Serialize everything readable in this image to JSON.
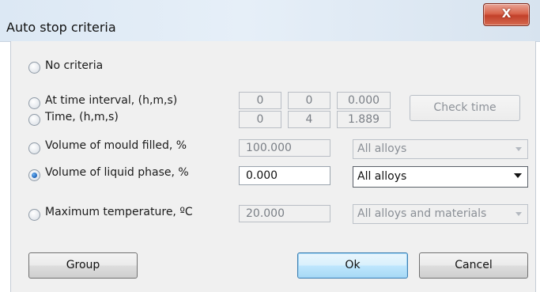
{
  "window": {
    "title": "Auto stop criteria",
    "close_glyph": "X",
    "close_icon": "close-icon"
  },
  "options": {
    "no_criteria": "No criteria",
    "time_interval": "At time interval, (h,m,s)",
    "time": "Time, (h,m,s)",
    "mould_filled": "Volume of mould filled, %",
    "liquid_phase": "Volume of liquid phase, %",
    "max_temperature": "Maximum temperature, ºC",
    "selected": "liquid_phase"
  },
  "fields": {
    "interval_h": "0",
    "interval_m": "0",
    "interval_s": "0.000",
    "time_h": "0",
    "time_m": "4",
    "time_s": "1.889",
    "mould_filled": "100.000",
    "liquid_phase": "0.000",
    "max_temperature": "20.000"
  },
  "combos": {
    "mould_filled_alloy": "All alloys",
    "liquid_phase_alloy": "All alloys",
    "max_temperature_material": "All alloys and materials"
  },
  "buttons": {
    "check_time": "Check time",
    "group": "Group",
    "ok": "Ok",
    "cancel": "Cancel"
  },
  "colors": {
    "dialog_background": "#f0f0f0",
    "default_button_accent": "#3c7fb1",
    "radio_checked": "#1f63b8"
  }
}
